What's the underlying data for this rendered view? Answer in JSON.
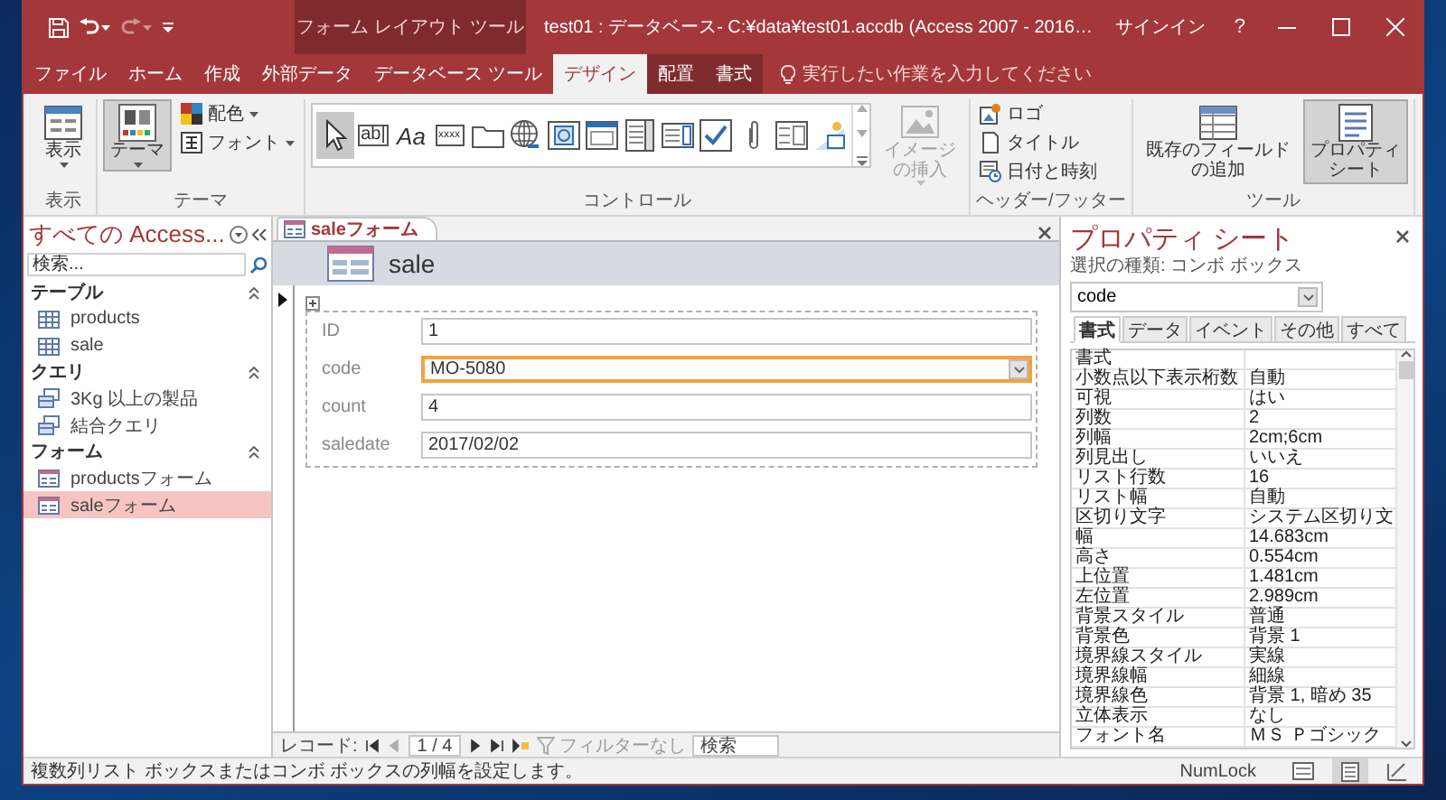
{
  "title_bar": {
    "quick_access": [
      {
        "kind": "save",
        "disabled": false,
        "dropdown": false
      },
      {
        "kind": "undo",
        "disabled": false,
        "dropdown": true
      },
      {
        "kind": "redo",
        "disabled": true,
        "dropdown": true
      },
      {
        "kind": "customize",
        "disabled": false,
        "dropdown": false
      }
    ],
    "context_label": "フォーム レイアウト ツール",
    "title": "test01 : データベース- C:¥data¥test01.accdb (Access 2007 - 2016…",
    "sign_in": "サインイン",
    "help": "?"
  },
  "ribbon_tabs": [
    {
      "label": "ファイル",
      "selected": false,
      "contextual": false
    },
    {
      "label": "ホーム",
      "selected": false,
      "contextual": false
    },
    {
      "label": "作成",
      "selected": false,
      "contextual": false
    },
    {
      "label": "外部データ",
      "selected": false,
      "contextual": false
    },
    {
      "label": "データベース ツール",
      "selected": false,
      "contextual": false
    },
    {
      "label": "デザイン",
      "selected": true,
      "contextual": true
    },
    {
      "label": "配置",
      "selected": false,
      "contextual": true
    },
    {
      "label": "書式",
      "selected": false,
      "contextual": true
    }
  ],
  "tell_me": "実行したい作業を入力してください",
  "ribbon_groups": [
    {
      "label": "表示",
      "items": [
        {
          "kind": "view",
          "label": "表示",
          "selected": false,
          "disabled": false,
          "dropdown": true
        }
      ]
    },
    {
      "label": "テーマ",
      "items": [
        {
          "kind": "theme",
          "label": "テーマ",
          "selected": true,
          "disabled": false,
          "dropdown": true
        },
        {
          "kind": "colors",
          "label": "配色",
          "selected": false,
          "disabled": false,
          "dropdown": true
        },
        {
          "kind": "fonts",
          "label": "フォント",
          "selected": false,
          "disabled": false,
          "dropdown": true
        }
      ]
    },
    {
      "label": "コントロール",
      "gallery": [
        {
          "kind": "pointer",
          "selected": true
        },
        {
          "kind": "textbox",
          "glyph": "ab|",
          "selected": false
        },
        {
          "kind": "label",
          "glyph": "Aa",
          "selected": false
        },
        {
          "kind": "button",
          "glyph": "xxxx",
          "selected": false
        },
        {
          "kind": "tab",
          "selected": false
        },
        {
          "kind": "hyperlink",
          "selected": false
        },
        {
          "kind": "browser",
          "selected": false
        },
        {
          "kind": "navigation",
          "selected": false
        },
        {
          "kind": "combobox",
          "selected": false
        },
        {
          "kind": "listbox",
          "selected": false
        },
        {
          "kind": "checkbox",
          "selected": false
        },
        {
          "kind": "attachment",
          "selected": false
        },
        {
          "kind": "subform",
          "selected": false
        },
        {
          "kind": "chart",
          "selected": false
        }
      ],
      "items": [
        {
          "kind": "image",
          "label": "イメージの挿入",
          "selected": false,
          "disabled": true,
          "dropdown": true
        }
      ]
    },
    {
      "label": "ヘッダー/フッター",
      "items": [
        {
          "kind": "logo",
          "label": "ロゴ",
          "selected": false,
          "disabled": false,
          "dropdown": false
        },
        {
          "kind": "title",
          "label": "タイトル",
          "selected": false,
          "disabled": false,
          "dropdown": false
        },
        {
          "kind": "datetime",
          "label": "日付と時刻",
          "selected": false,
          "disabled": false,
          "dropdown": false
        }
      ]
    },
    {
      "label": "ツール",
      "items": [
        {
          "kind": "fields",
          "label": "既存のフィールドの追加",
          "selected": false,
          "disabled": false,
          "dropdown": false
        },
        {
          "kind": "sheet",
          "label": "プロパティシート",
          "selected": true,
          "disabled": false,
          "dropdown": false
        }
      ]
    }
  ],
  "nav_pane": {
    "title": "すべての Access...",
    "search_placeholder": "検索...",
    "sections": [
      {
        "label": "テーブル",
        "expanded": true,
        "items": [
          {
            "kind": "table",
            "label": "products",
            "selected": false
          },
          {
            "kind": "table",
            "label": "sale",
            "selected": false
          }
        ]
      },
      {
        "label": "クエリ",
        "expanded": true,
        "items": [
          {
            "kind": "query",
            "label": "3Kg 以上の製品",
            "selected": false
          },
          {
            "kind": "query",
            "label": "結合クエリ",
            "selected": false
          }
        ]
      },
      {
        "label": "フォーム",
        "expanded": true,
        "items": [
          {
            "kind": "form",
            "label": "productsフォーム",
            "selected": false
          },
          {
            "kind": "form",
            "label": "saleフォーム",
            "selected": true
          }
        ]
      }
    ]
  },
  "document": {
    "tab": "saleフォーム",
    "header": "sale",
    "fields": [
      {
        "kind": "text",
        "label": "ID",
        "value": "1",
        "focused": false
      },
      {
        "kind": "combo",
        "label": "code",
        "value": "MO-5080",
        "focused": true
      },
      {
        "kind": "text",
        "label": "count",
        "value": "4",
        "focused": false
      },
      {
        "kind": "text",
        "label": "saledate",
        "value": "2017/02/02",
        "focused": false
      }
    ],
    "record_nav": {
      "label": "レコード:",
      "position": "1 / 4",
      "buttons": [
        {
          "kind": "first",
          "disabled": false
        },
        {
          "kind": "prev",
          "disabled": true
        },
        {
          "kind": "next",
          "disabled": false
        },
        {
          "kind": "last",
          "disabled": false
        },
        {
          "kind": "new",
          "disabled": false
        }
      ],
      "filter": {
        "label": "フィルターなし",
        "disabled": true
      },
      "search": "検索"
    }
  },
  "property_sheet": {
    "title": "プロパティ シート",
    "selection_type": "選択の種類: コンボ ボックス",
    "object": "code",
    "tabs": [
      {
        "label": "書式",
        "selected": true
      },
      {
        "label": "データ",
        "selected": false
      },
      {
        "label": "イベント",
        "selected": false
      },
      {
        "label": "その他",
        "selected": false
      },
      {
        "label": "すべて",
        "selected": false
      }
    ],
    "rows": [
      {
        "name": "書式"
      },
      {
        "name": "小数点以下表示桁数",
        "value": "自動"
      },
      {
        "name": "可視",
        "value": "はい"
      },
      {
        "name": "列数",
        "value": "2"
      },
      {
        "name": "列幅",
        "value": "2cm;6cm"
      },
      {
        "name": "列見出し",
        "value": "いいえ"
      },
      {
        "name": "リスト行数",
        "value": "16"
      },
      {
        "name": "リスト幅",
        "value": "自動"
      },
      {
        "name": "区切り文字",
        "value": "システム区切り文"
      },
      {
        "name": "幅",
        "value": "14.683cm"
      },
      {
        "name": "高さ",
        "value": "0.554cm"
      },
      {
        "name": "上位置",
        "value": "1.481cm"
      },
      {
        "name": "左位置",
        "value": "2.989cm"
      },
      {
        "name": "背景スタイル",
        "value": "普通"
      },
      {
        "name": "背景色",
        "value": "背景 1"
      },
      {
        "name": "境界線スタイル",
        "value": "実線"
      },
      {
        "name": "境界線幅",
        "value": "細線"
      },
      {
        "name": "境界線色",
        "value": "背景 1, 暗め 35"
      },
      {
        "name": "立体表示",
        "value": "なし"
      },
      {
        "name": "フォント名",
        "value": "ＭＳ Ｐゴシック"
      }
    ]
  },
  "status_bar": {
    "message": "複数列リスト ボックスまたはコンボ ボックスの列幅を設定します。",
    "numlock": "NumLock",
    "views": [
      {
        "kind": "form",
        "selected": false
      },
      {
        "kind": "layout",
        "selected": true
      },
      {
        "kind": "design",
        "selected": false
      }
    ]
  }
}
